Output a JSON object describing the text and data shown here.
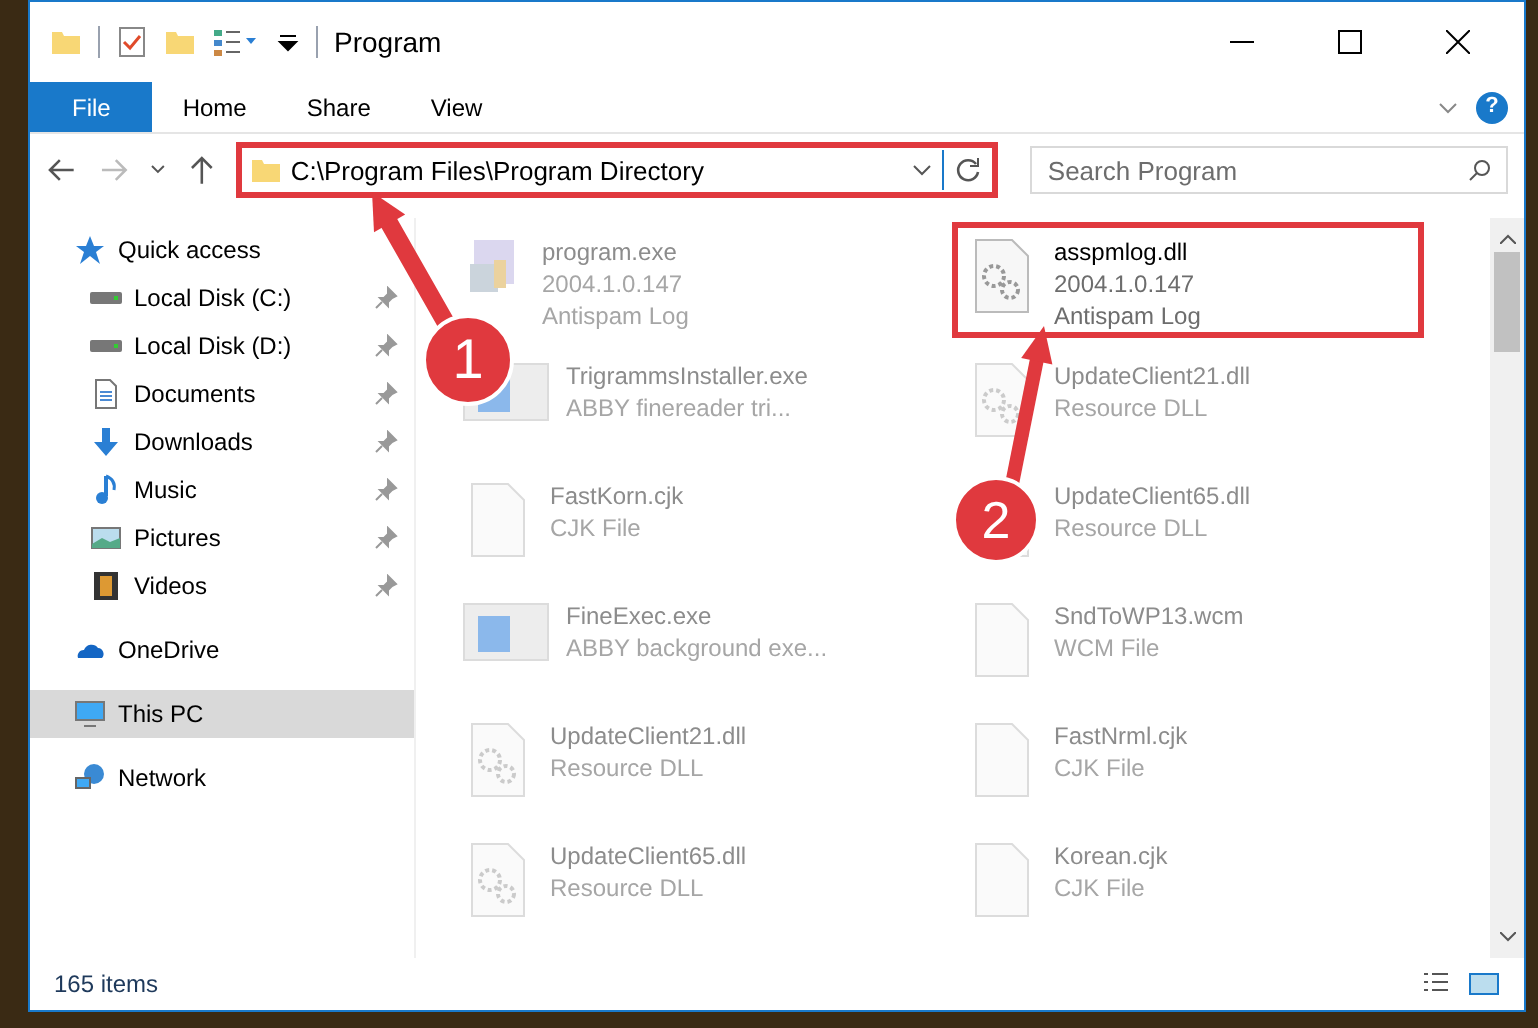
{
  "window": {
    "title": "Program"
  },
  "ribbon_tabs": [
    {
      "label": "File",
      "selected": true
    },
    {
      "label": "Home",
      "selected": false
    },
    {
      "label": "Share",
      "selected": false
    },
    {
      "label": "View",
      "selected": false
    }
  ],
  "help_button": {
    "label": "?"
  },
  "address": {
    "path": "C:\\Program Files\\Program Directory",
    "highlighted": true
  },
  "search": {
    "placeholder": "Search Program"
  },
  "sidebar": {
    "items": [
      {
        "label": "Quick access",
        "kind": "star",
        "pinned": false,
        "selected": false
      },
      {
        "label": "Local Disk (C:)",
        "kind": "drive",
        "pinned": true,
        "selected": false
      },
      {
        "label": "Local Disk (D:)",
        "kind": "drive",
        "pinned": true,
        "selected": false
      },
      {
        "label": "Documents",
        "kind": "doc",
        "pinned": true,
        "selected": false
      },
      {
        "label": "Downloads",
        "kind": "download",
        "pinned": true,
        "selected": false
      },
      {
        "label": "Music",
        "kind": "music",
        "pinned": true,
        "selected": false
      },
      {
        "label": "Pictures",
        "kind": "picture",
        "pinned": true,
        "selected": false
      },
      {
        "label": "Videos",
        "kind": "video",
        "pinned": true,
        "selected": false
      },
      {
        "label": "OneDrive",
        "kind": "cloud",
        "pinned": false,
        "selected": false
      },
      {
        "label": "This PC",
        "kind": "pc",
        "pinned": false,
        "selected": true
      },
      {
        "label": "Network",
        "kind": "network",
        "pinned": false,
        "selected": false
      }
    ]
  },
  "files": {
    "columns": [
      [
        {
          "name": "program.exe",
          "lines": [
            "2004.1.0.147",
            "Antispam Log"
          ],
          "kind": "installer",
          "faded": true,
          "highlighted": false
        },
        {
          "name": "TrigrammsInstaller.exe",
          "lines": [
            "ABBY finereader tri..."
          ],
          "kind": "app",
          "faded": true,
          "highlighted": false
        },
        {
          "name": "FastKorn.cjk",
          "lines": [
            "CJK File"
          ],
          "kind": "blank",
          "faded": true,
          "highlighted": false
        },
        {
          "name": "FineExec.exe",
          "lines": [
            "ABBY background exe..."
          ],
          "kind": "app",
          "faded": true,
          "highlighted": false
        },
        {
          "name": "UpdateClient21.dll",
          "lines": [
            "Resource DLL"
          ],
          "kind": "dll",
          "faded": true,
          "highlighted": false
        },
        {
          "name": "UpdateClient65.dll",
          "lines": [
            "Resource DLL"
          ],
          "kind": "dll",
          "faded": true,
          "highlighted": false
        }
      ],
      [
        {
          "name": "asspmlog.dll",
          "lines": [
            "2004.1.0.147",
            "Antispam Log"
          ],
          "kind": "dll",
          "faded": false,
          "highlighted": true
        },
        {
          "name": "UpdateClient21.dll",
          "lines": [
            "Resource DLL"
          ],
          "kind": "dll",
          "faded": true,
          "highlighted": false
        },
        {
          "name": "UpdateClient65.dll",
          "lines": [
            "Resource DLL"
          ],
          "kind": "dll",
          "faded": true,
          "highlighted": false
        },
        {
          "name": "SndToWP13.wcm",
          "lines": [
            "WCM File"
          ],
          "kind": "blank",
          "faded": true,
          "highlighted": false
        },
        {
          "name": "FastNrml.cjk",
          "lines": [
            "CJK File"
          ],
          "kind": "blank",
          "faded": true,
          "highlighted": false
        },
        {
          "name": "Korean.cjk",
          "lines": [
            "CJK File"
          ],
          "kind": "blank",
          "faded": true,
          "highlighted": false
        }
      ]
    ]
  },
  "status_bar": {
    "count": "165 items"
  },
  "callouts": [
    {
      "number": "1"
    },
    {
      "number": "2"
    }
  ]
}
